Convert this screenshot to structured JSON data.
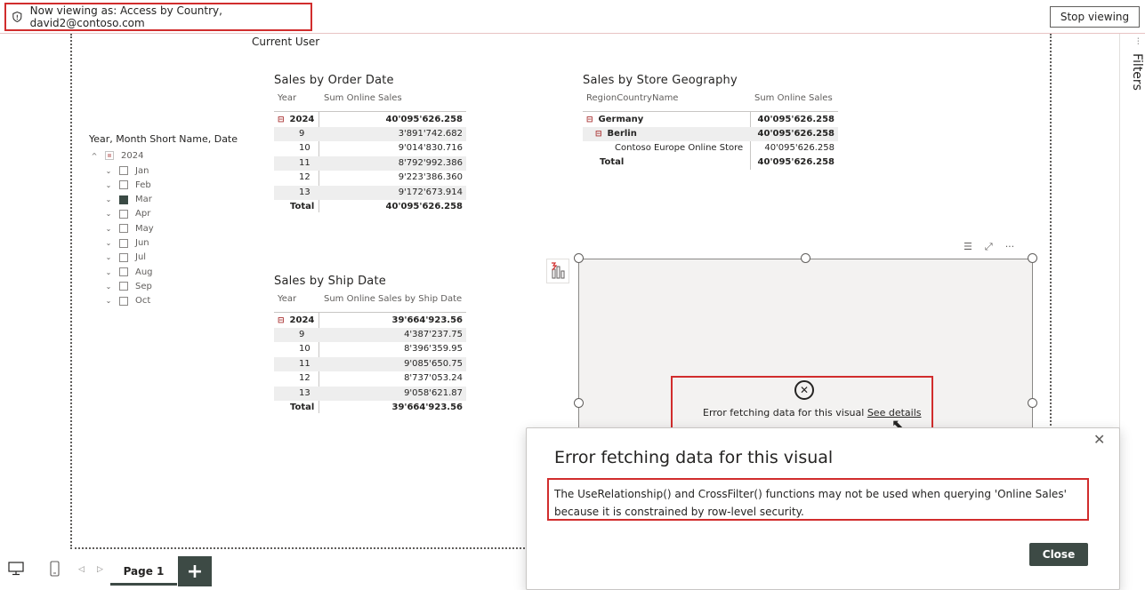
{
  "topbar": {
    "viewing_text": "Now viewing as: Access by Country, david2@contoso.com",
    "stop_label": "Stop viewing"
  },
  "filters_label": "Filters",
  "current_user_label": "Current User",
  "slicer": {
    "title": "Year, Month Short Name, Date",
    "year": "2024",
    "months": [
      "Jan",
      "Feb",
      "Mar",
      "Apr",
      "May",
      "Jun",
      "Jul",
      "Aug",
      "Sep",
      "Oct"
    ],
    "selected_month": "Mar"
  },
  "order_table": {
    "title": "Sales by Order Date",
    "col1": "Year",
    "col2": "Sum Online Sales",
    "year": "2024",
    "year_total": "40'095'626.258",
    "rows": [
      {
        "k": "9",
        "v": "3'891'742.682"
      },
      {
        "k": "10",
        "v": "9'014'830.716"
      },
      {
        "k": "11",
        "v": "8'792'992.386"
      },
      {
        "k": "12",
        "v": "9'223'386.360"
      },
      {
        "k": "13",
        "v": "9'172'673.914"
      }
    ],
    "total_label": "Total",
    "total": "40'095'626.258"
  },
  "geo_table": {
    "title": "Sales by Store Geography",
    "col1": "RegionCountryName",
    "col2": "Sum Online Sales",
    "country": "Germany",
    "country_total": "40'095'626.258",
    "city": "Berlin",
    "city_total": "40'095'626.258",
    "store": "Contoso Europe Online Store",
    "store_total": "40'095'626.258",
    "total_label": "Total",
    "total": "40'095'626.258"
  },
  "ship_table": {
    "title": "Sales by Ship Date",
    "col1": "Year",
    "col2": "Sum Online Sales by Ship Date",
    "year": "2024",
    "year_total": "39'664'923.56",
    "rows": [
      {
        "k": "9",
        "v": "4'387'237.75"
      },
      {
        "k": "10",
        "v": "8'396'359.95"
      },
      {
        "k": "11",
        "v": "9'085'650.75"
      },
      {
        "k": "12",
        "v": "8'737'053.24"
      },
      {
        "k": "13",
        "v": "9'058'621.87"
      }
    ],
    "total_label": "Total",
    "total": "39'664'923.56"
  },
  "visual_error": {
    "text": "Error fetching data for this visual",
    "link": "See details"
  },
  "dialog": {
    "title": "Error fetching data for this visual",
    "message": "The UseRelationship() and CrossFilter() functions may not be used when querying 'Online Sales' because it is constrained by row-level security.",
    "close_label": "Close"
  },
  "bottom": {
    "page_tab": "Page 1",
    "add_label": "+"
  },
  "colors": {
    "highlight_red": "#d12d2d",
    "dark_button": "#3d4a45"
  }
}
